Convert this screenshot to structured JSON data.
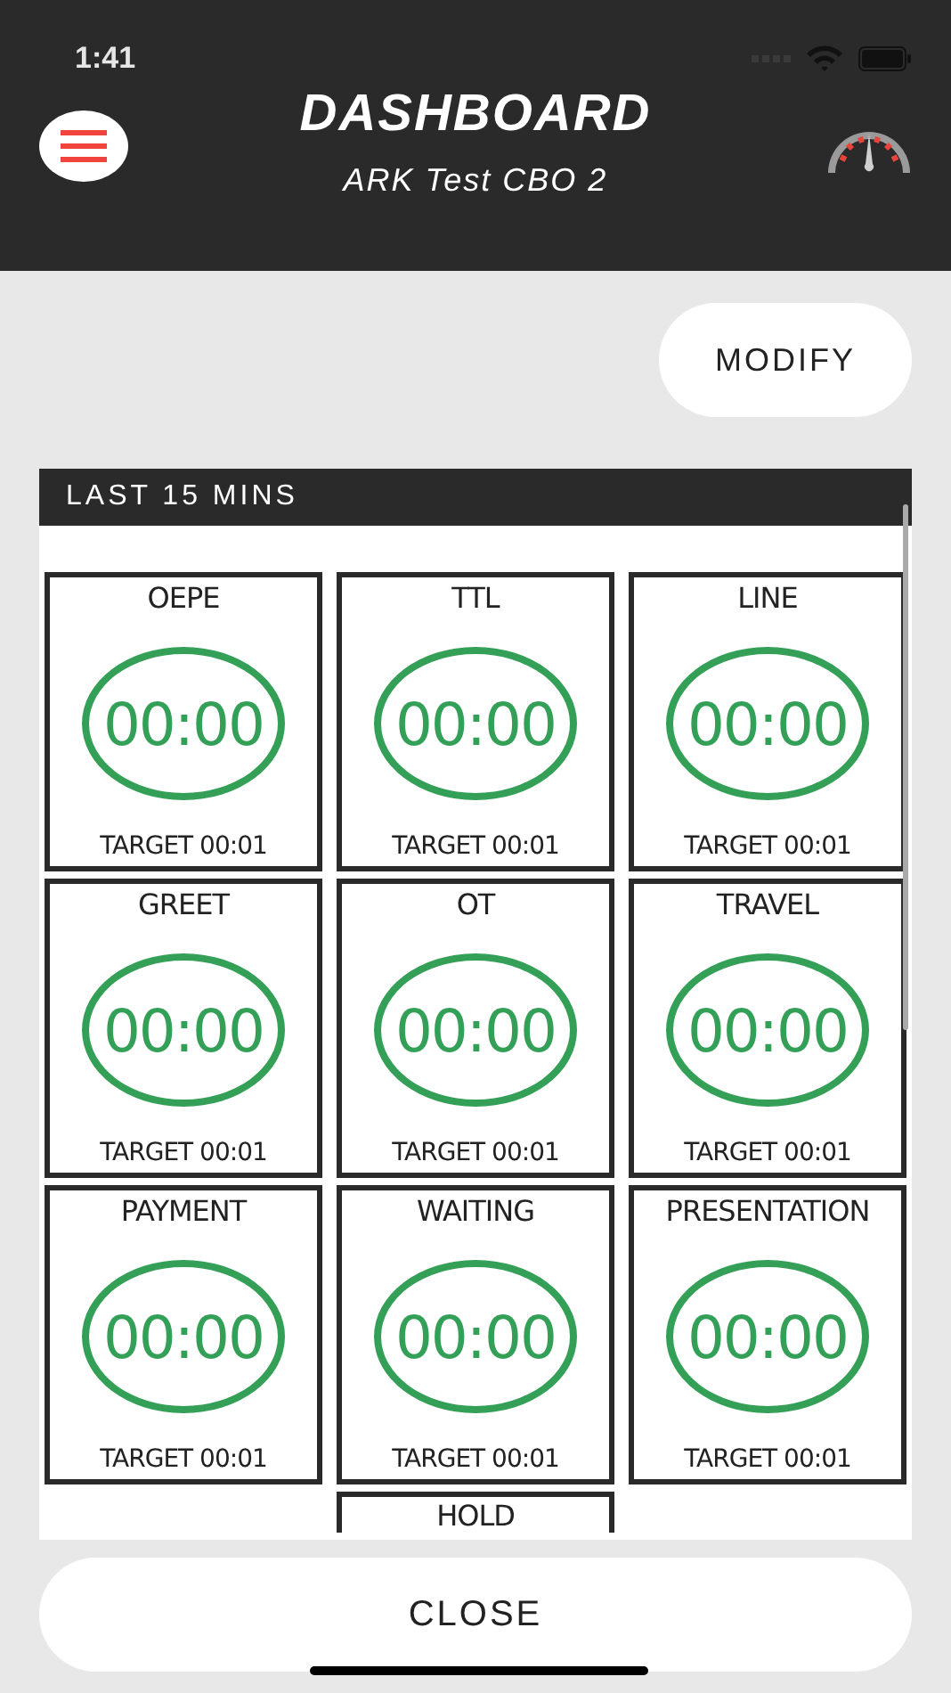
{
  "status_bar": {
    "time": "1:41"
  },
  "header": {
    "title": "DASHBOARD",
    "subtitle": "ARK Test CBO 2"
  },
  "modify_button": "MODIFY",
  "panel": {
    "title": "LAST 15 MINS",
    "tiles": [
      {
        "label": "OEPE",
        "value": "00:00",
        "target": "TARGET 00:01"
      },
      {
        "label": "TTL",
        "value": "00:00",
        "target": "TARGET 00:01"
      },
      {
        "label": "LINE",
        "value": "00:00",
        "target": "TARGET 00:01"
      },
      {
        "label": "GREET",
        "value": "00:00",
        "target": "TARGET 00:01"
      },
      {
        "label": "OT",
        "value": "00:00",
        "target": "TARGET 00:01"
      },
      {
        "label": "TRAVEL",
        "value": "00:00",
        "target": "TARGET 00:01"
      },
      {
        "label": "PAYMENT",
        "value": "00:00",
        "target": "TARGET 00:01"
      },
      {
        "label": "WAITING",
        "value": "00:00",
        "target": "TARGET 00:01"
      },
      {
        "label": "PRESENTATION",
        "value": "00:00",
        "target": "TARGET 00:01"
      },
      {
        "label": "HOLD"
      }
    ]
  },
  "close_button": "CLOSE"
}
